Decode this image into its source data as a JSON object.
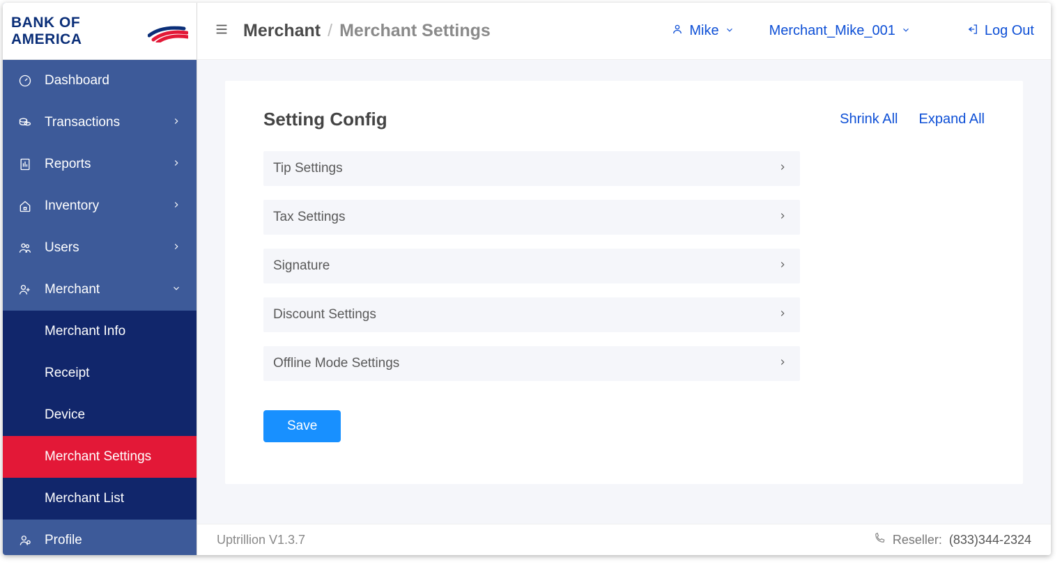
{
  "brand": {
    "name": "BANK OF AMERICA"
  },
  "sidebar": {
    "items": [
      {
        "label": "Dashboard",
        "icon": "gauge",
        "expandable": false
      },
      {
        "label": "Transactions",
        "icon": "coins",
        "expandable": true
      },
      {
        "label": "Reports",
        "icon": "report",
        "expandable": true
      },
      {
        "label": "Inventory",
        "icon": "house",
        "expandable": true
      },
      {
        "label": "Users",
        "icon": "users",
        "expandable": true
      },
      {
        "label": "Merchant",
        "icon": "merchant",
        "expandable": true,
        "expanded": true,
        "children": [
          {
            "label": "Merchant Info"
          },
          {
            "label": "Receipt"
          },
          {
            "label": "Device"
          },
          {
            "label": "Merchant Settings",
            "active": true
          },
          {
            "label": "Merchant List"
          }
        ]
      },
      {
        "label": "Profile",
        "icon": "profile",
        "expandable": false
      }
    ]
  },
  "header": {
    "breadcrumb_root": "Merchant",
    "breadcrumb_current": "Merchant Settings",
    "user_name": "Mike",
    "merchant_id": "Merchant_Mike_001",
    "logout_label": "Log Out"
  },
  "settings": {
    "title": "Setting Config",
    "shrink_label": "Shrink All",
    "expand_label": "Expand All",
    "panels": [
      {
        "label": "Tip Settings"
      },
      {
        "label": "Tax Settings"
      },
      {
        "label": "Signature"
      },
      {
        "label": "Discount Settings"
      },
      {
        "label": "Offline Mode Settings"
      }
    ],
    "save_label": "Save"
  },
  "footer": {
    "version": "Uptrillion V1.3.7",
    "reseller_label": "Reseller:",
    "reseller_phone": "(833)344-2324"
  }
}
